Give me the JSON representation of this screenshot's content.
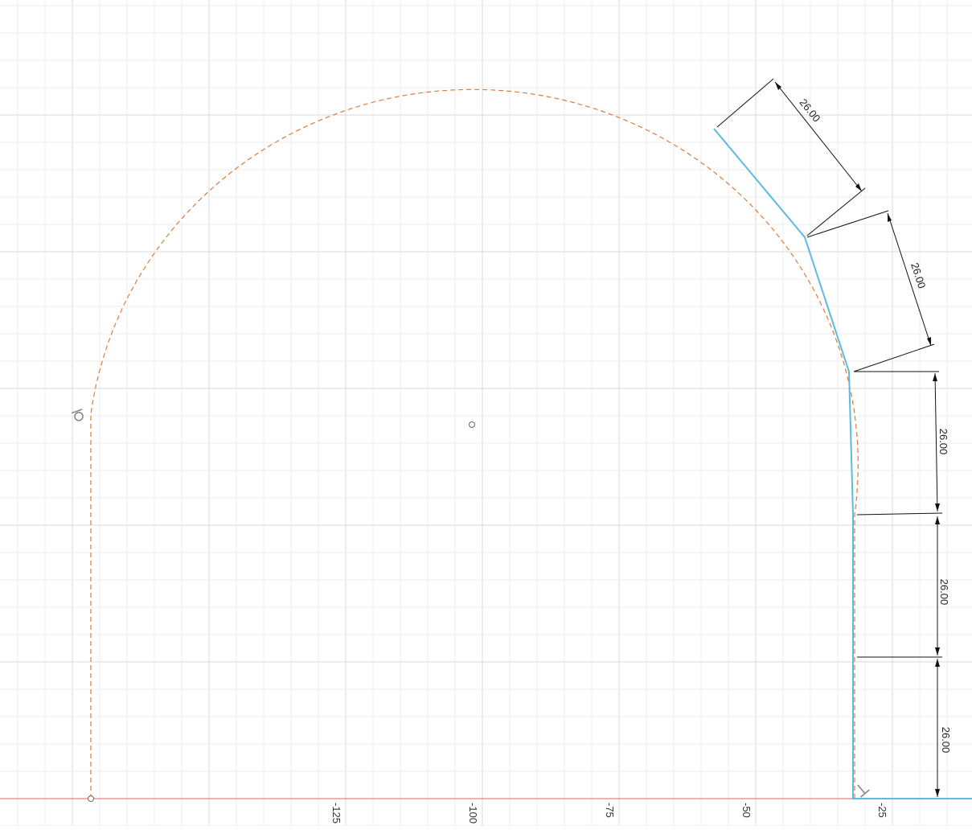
{
  "canvas": {
    "background": "#ffffff",
    "grid_minor_color": "#eeeeee",
    "grid_major_color": "#d9d9d9",
    "axis_x_color": "#e88080",
    "construction_color": "#e07b39",
    "profile_color": "#5bbbe0",
    "dimension_color": "#111111"
  },
  "axis_labels": [
    "-125",
    "-100",
    "-75",
    "-50",
    "-25"
  ],
  "dimensions": [
    {
      "id": "dim-1",
      "value": "26.00"
    },
    {
      "id": "dim-2",
      "value": "26.00"
    },
    {
      "id": "dim-3",
      "value": "26.00"
    },
    {
      "id": "dim-4",
      "value": "26.00"
    },
    {
      "id": "dim-5",
      "value": "26.00"
    }
  ],
  "icons": {
    "tangent_constraint": "tangent-constraint-icon",
    "perpendicular_constraint": "perpendicular-constraint-icon",
    "center_point": "center-point-icon",
    "end_point": "end-point-icon"
  }
}
